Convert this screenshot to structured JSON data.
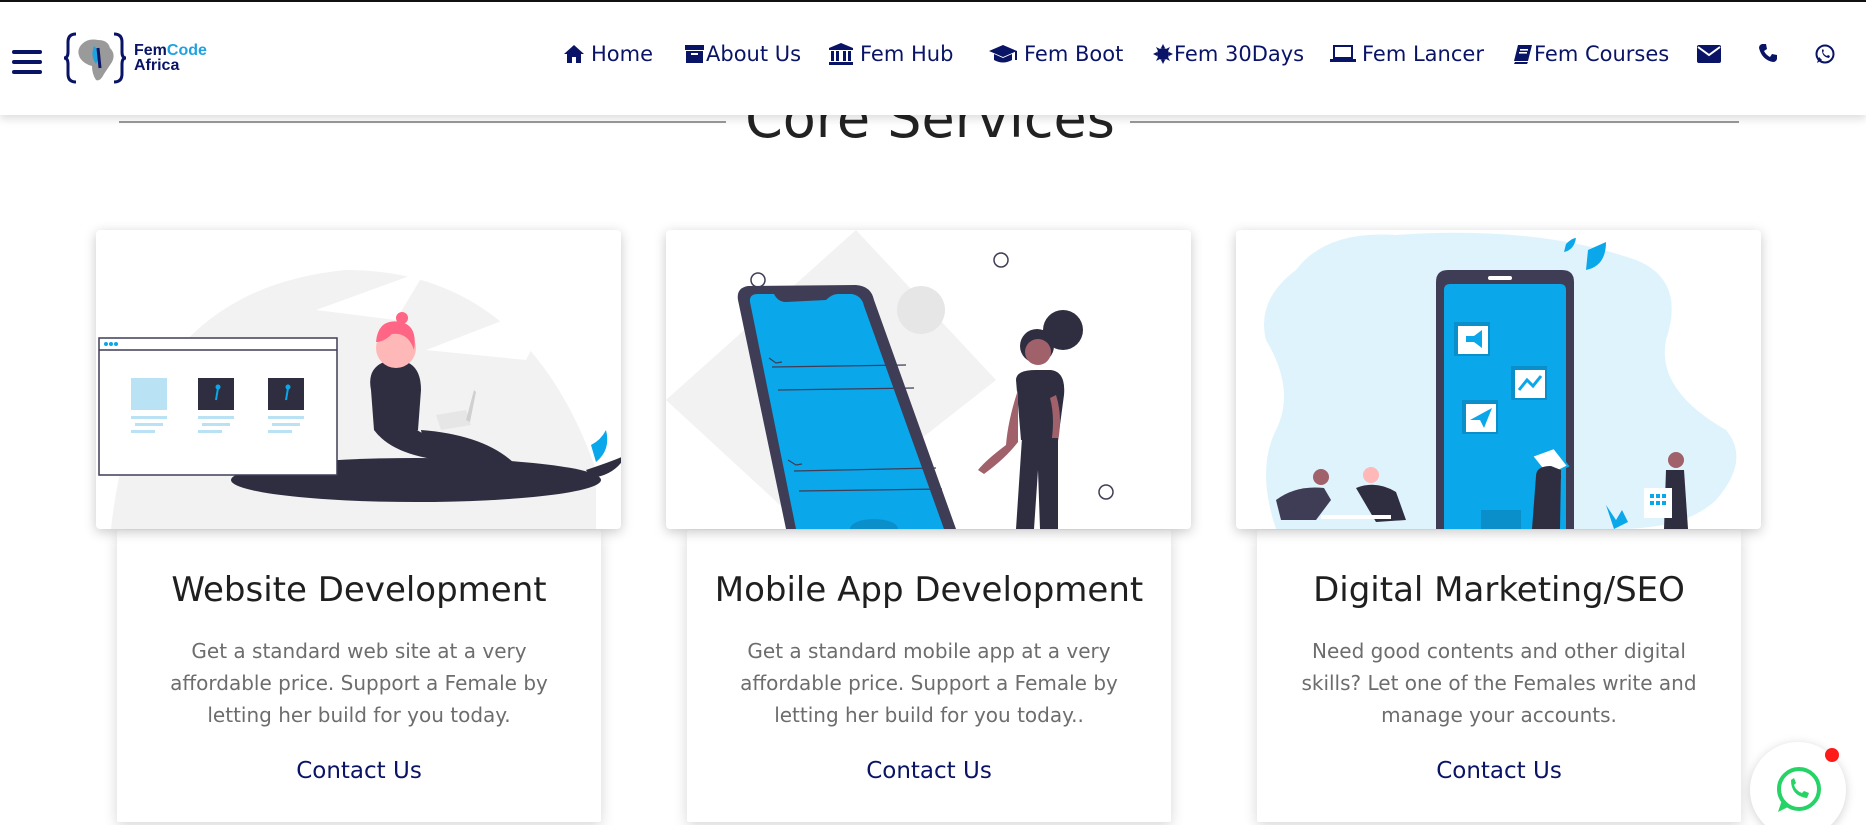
{
  "brand": {
    "line1_a": "Fem",
    "line1_b": "Code",
    "line2": "Africa"
  },
  "nav": {
    "home": "Home",
    "about": "About Us",
    "hub": "Fem Hub",
    "boot": "Fem Boot",
    "days": "Fem 30Days",
    "lancer": "Fem Lancer",
    "courses": "Fem Courses"
  },
  "icons": {
    "menu": "hamburger-icon",
    "home": "home-icon",
    "about": "archive-icon",
    "hub": "bank-icon",
    "boot": "graduation-cap-icon",
    "days": "sun-burst-icon",
    "lancer": "laptop-icon",
    "courses": "book-icon",
    "mail": "envelope-icon",
    "phone": "phone-icon",
    "whatsapp": "whatsapp-icon"
  },
  "section": {
    "title": "Core Services"
  },
  "services": [
    {
      "title": "Website Development",
      "text": "Get a standard web site at a very affordable price. Support a Female by letting her build for you today.",
      "link": "Contact Us"
    },
    {
      "title": "Mobile App Development",
      "text": "Get a standard mobile app at a very affordable price. Support a Female by letting her build for you today..",
      "link": "Contact Us"
    },
    {
      "title": "Digital Marketing/SEO",
      "text": "Need good contents and other digital skills? Let one of the Females write and manage your accounts.",
      "link": "Contact Us"
    }
  ],
  "colors": {
    "navy": "#0a1466",
    "accent": "#1ea3e0",
    "illustration_blue": "#0aa7ea",
    "dark": "#2f2e41",
    "pink": "#ff6584"
  }
}
